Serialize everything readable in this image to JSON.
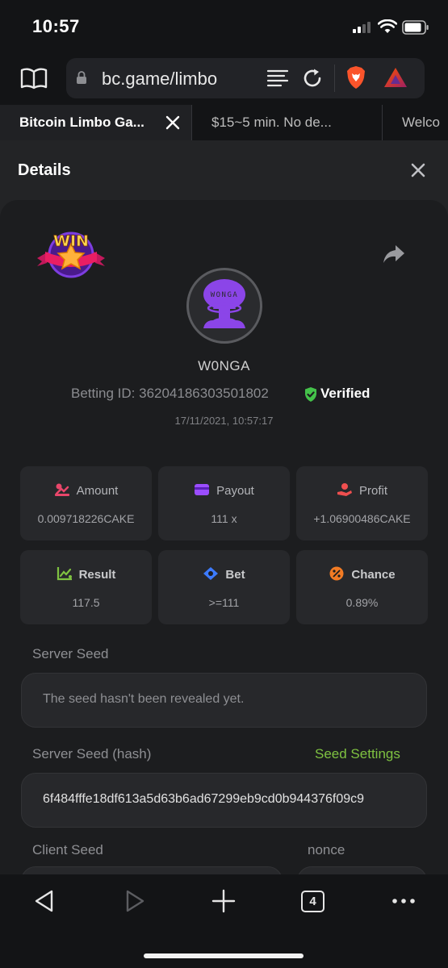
{
  "status_bar": {
    "time": "10:57"
  },
  "browser": {
    "url": "bc.game/limbo",
    "tabs": [
      {
        "label": "Bitcoin Limbo Ga...",
        "active": true
      },
      {
        "label": "$15~5 min. No de...",
        "active": false
      },
      {
        "label": "Welco",
        "active": false
      }
    ],
    "open_tab_count": "4"
  },
  "modal": {
    "title": "Details",
    "badge_text": "WIN",
    "avatar_text": "WONGA",
    "username": "W0NGA",
    "betting_id_label": "Betting ID:",
    "betting_id": "36204186303501802",
    "verified_label": "Verified",
    "date": "17/11/2021, 10:57:17",
    "stats": [
      {
        "label": "Amount",
        "value": "0.009718226CAKE",
        "icon": "money-bag-icon"
      },
      {
        "label": "Payout",
        "value": "111 x",
        "icon": "wallet-card-icon"
      },
      {
        "label": "Profit",
        "value": "+1.06900486CAKE",
        "icon": "hand-coins-icon"
      },
      {
        "label": "Result",
        "value": "117.5",
        "icon": "chart-trend-icon"
      },
      {
        "label": "Bet",
        "value": ">=111",
        "icon": "ticket-icon"
      },
      {
        "label": "Chance",
        "value": "0.89%",
        "icon": "percent-icon"
      }
    ],
    "server_seed_label": "Server Seed",
    "server_seed_value": "The seed hasn't been revealed yet.",
    "server_seed_hash_label": "Server Seed (hash)",
    "seed_settings_label": "Seed Settings",
    "server_seed_hash": "6f484fffe18df613a5d63b6ad67299eb9cd0b944376f09c9",
    "client_seed_label": "Client Seed",
    "nonce_label": "nonce"
  },
  "colors": {
    "accent_green": "#7fc241",
    "verified_green": "#44c24a",
    "avatar_purple": "#8b45e8",
    "page_bg": "#1c1d1f",
    "card_bg": "#27282b"
  }
}
